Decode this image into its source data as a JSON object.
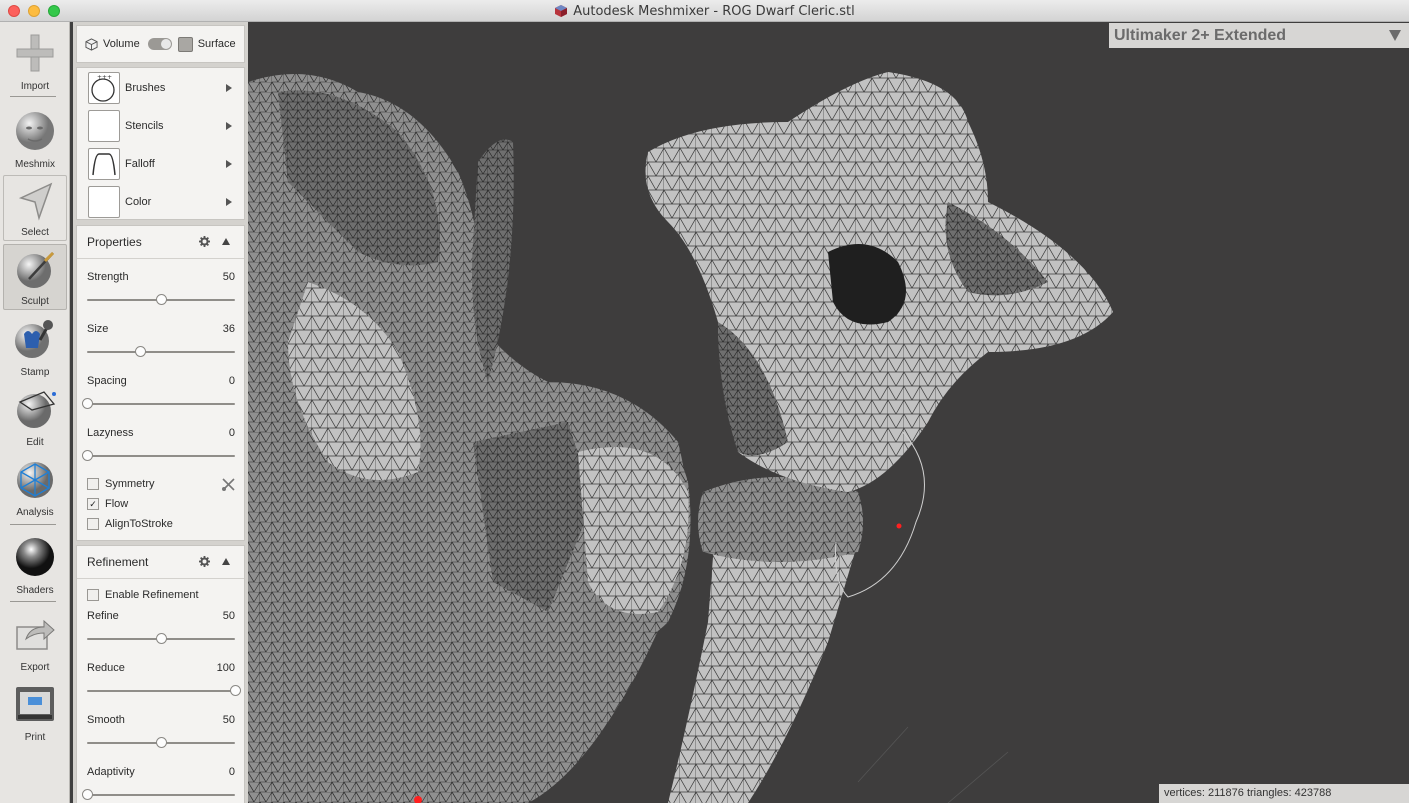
{
  "window": {
    "title": "Autodesk Meshmixer - ROG Dwarf Cleric.stl"
  },
  "toolbar": {
    "import": "Import",
    "meshmix": "Meshmix",
    "select": "Select",
    "sculpt": "Sculpt",
    "stamp": "Stamp",
    "edit": "Edit",
    "analysis": "Analysis",
    "shaders": "Shaders",
    "export": "Export",
    "print": "Print"
  },
  "mode": {
    "volume": "Volume",
    "surface": "Surface"
  },
  "brush_menu": {
    "brushes": "Brushes",
    "stencils": "Stencils",
    "falloff": "Falloff",
    "color": "Color"
  },
  "properties": {
    "title": "Properties",
    "strength": {
      "label": "Strength",
      "value": "50",
      "fraction": 0.5
    },
    "size": {
      "label": "Size",
      "value": "36",
      "fraction": 0.36
    },
    "spacing": {
      "label": "Spacing",
      "value": "0",
      "fraction": 0
    },
    "lazyness": {
      "label": "Lazyness",
      "value": "0",
      "fraction": 0
    },
    "symmetry": {
      "label": "Symmetry",
      "checked": false
    },
    "flow": {
      "label": "Flow",
      "checked": true
    },
    "align": {
      "label": "AlignToStroke",
      "checked": false
    }
  },
  "refinement": {
    "title": "Refinement",
    "enable": {
      "label": "Enable Refinement",
      "checked": false
    },
    "refine": {
      "label": "Refine",
      "value": "50",
      "fraction": 0.5
    },
    "reduce": {
      "label": "Reduce",
      "value": "100",
      "fraction": 1.0
    },
    "smooth": {
      "label": "Smooth",
      "value": "50",
      "fraction": 0.5
    },
    "adaptivity": {
      "label": "Adaptivity",
      "value": "0",
      "fraction": 0
    }
  },
  "viewport": {
    "printer": "Ultimaker 2+ Extended",
    "status": "vertices: 211876 triangles: 423788"
  },
  "colors": {
    "viewport_bg": "#3e3d3d",
    "panel_bg": "#f4f3f1",
    "mesh": "#9a9a9a"
  }
}
